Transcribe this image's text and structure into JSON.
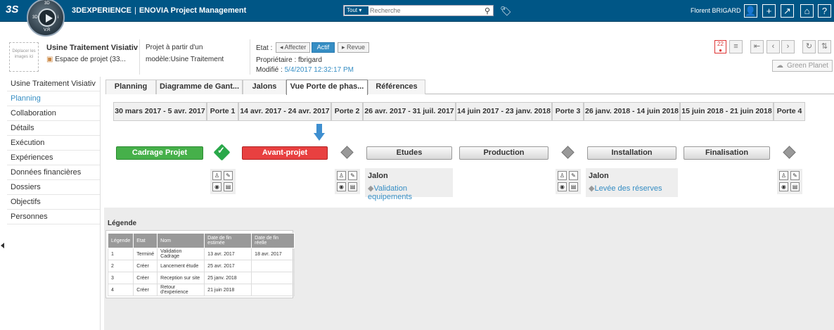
{
  "topbar": {
    "brand": "3DEXPERIENCE",
    "app": "ENOVIA Project Management",
    "search_scope": "Tout",
    "search_placeholder": "Recherche",
    "user": "Florent BRIGARD",
    "compass": {
      "top": "3D",
      "v": "V.R",
      "left": "3D",
      "right": "i"
    }
  },
  "project": {
    "drag_text": "Déplacer les images ici",
    "name": "Usine Traitement Visiativ",
    "space": "Espace de projet (33...",
    "model_line1": "Projet à partir d'un",
    "model_line2": "modèle:Usine Traitement",
    "etat_label": "Etat :",
    "etat_buttons": [
      "Affecter",
      "Actif",
      "Revue"
    ],
    "owner": "Propriétaire : fbrigard",
    "modified_label": "Modifié : ",
    "modified_value": "5/4/2017 12:32:17 PM",
    "badge_count": "22",
    "green_planet": "Green Planet"
  },
  "sidebar": {
    "items": [
      "Usine Traitement Visiativ",
      "Planning",
      "Collaboration",
      "Détails",
      "Exécution",
      "Expériences",
      "Données financières",
      "Dossiers",
      "Objectifs",
      "Personnes"
    ]
  },
  "tabs": [
    "Planning",
    "Diagramme de Gant...",
    "Jalons",
    "Vue Porte de phas...",
    "Références"
  ],
  "columns": [
    "30 mars 2017 - 5 avr. 2017",
    "Porte 1",
    "14 avr. 2017 - 24 avr. 2017",
    "Porte 2",
    "26 avr. 2017 - 31 juil. 2017",
    "14 juin 2017 - 23 janv. 2018",
    "Porte 3",
    "26 janv. 2018 - 14 juin 2018",
    "15 juin 2018 - 21 juin 2018",
    "Porte 4"
  ],
  "phases": [
    "Cadrage Projet",
    "Avant-projet",
    "Etudes",
    "Production",
    "Installation",
    "Finalisation"
  ],
  "jalons": [
    {
      "title": "Jalon",
      "link": "Validation equipements"
    },
    {
      "title": "Jalon",
      "link": "Levée des réserves"
    }
  ],
  "legend": {
    "title": "Légende",
    "headers": [
      "Légende",
      "Etat",
      "Nom",
      "Date de fin estimée",
      "Date de fin réelle"
    ],
    "rows": [
      [
        "1",
        "Terminé",
        "Validation Cadrage",
        "13 avr. 2017",
        "18 avr. 2017"
      ],
      [
        "2",
        "Créer",
        "Lancement étude",
        "25 avr. 2017",
        ""
      ],
      [
        "3",
        "Créer",
        "Reception sur site",
        "25 janv. 2018",
        ""
      ],
      [
        "4",
        "Créer",
        "Retour d'experience",
        "21 juin 2018",
        ""
      ]
    ]
  }
}
